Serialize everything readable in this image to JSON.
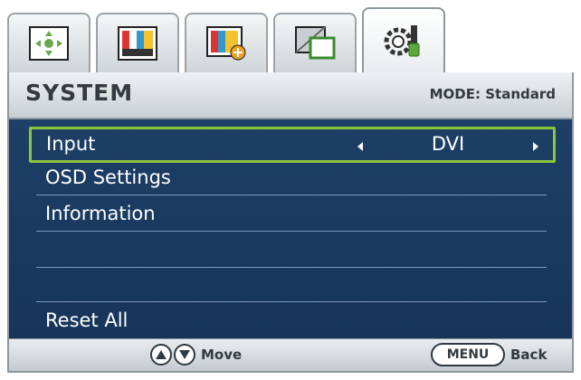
{
  "tabs": [
    {
      "icon": "picture-adjust-icon",
      "active": false
    },
    {
      "icon": "color-bars-icon",
      "active": false
    },
    {
      "icon": "picture-advanced-icon",
      "active": false
    },
    {
      "icon": "display-icon",
      "active": false
    },
    {
      "icon": "system-gear-icon",
      "active": true
    }
  ],
  "header": {
    "title": "SYSTEM",
    "mode": "MODE: Standard"
  },
  "menu": {
    "items": [
      {
        "label": "Input",
        "value": "DVI",
        "selected": true
      },
      {
        "label": "OSD Settings"
      },
      {
        "label": "Information"
      },
      {
        "label": ""
      },
      {
        "label": ""
      },
      {
        "label": "Reset All"
      }
    ]
  },
  "footer": {
    "move_label": "Move",
    "menu_key": "MENU",
    "back_label": "Back"
  },
  "colors": {
    "body_bg": "#1e3f66",
    "selection_border": "#8cc63e",
    "text": "#ffffff"
  }
}
